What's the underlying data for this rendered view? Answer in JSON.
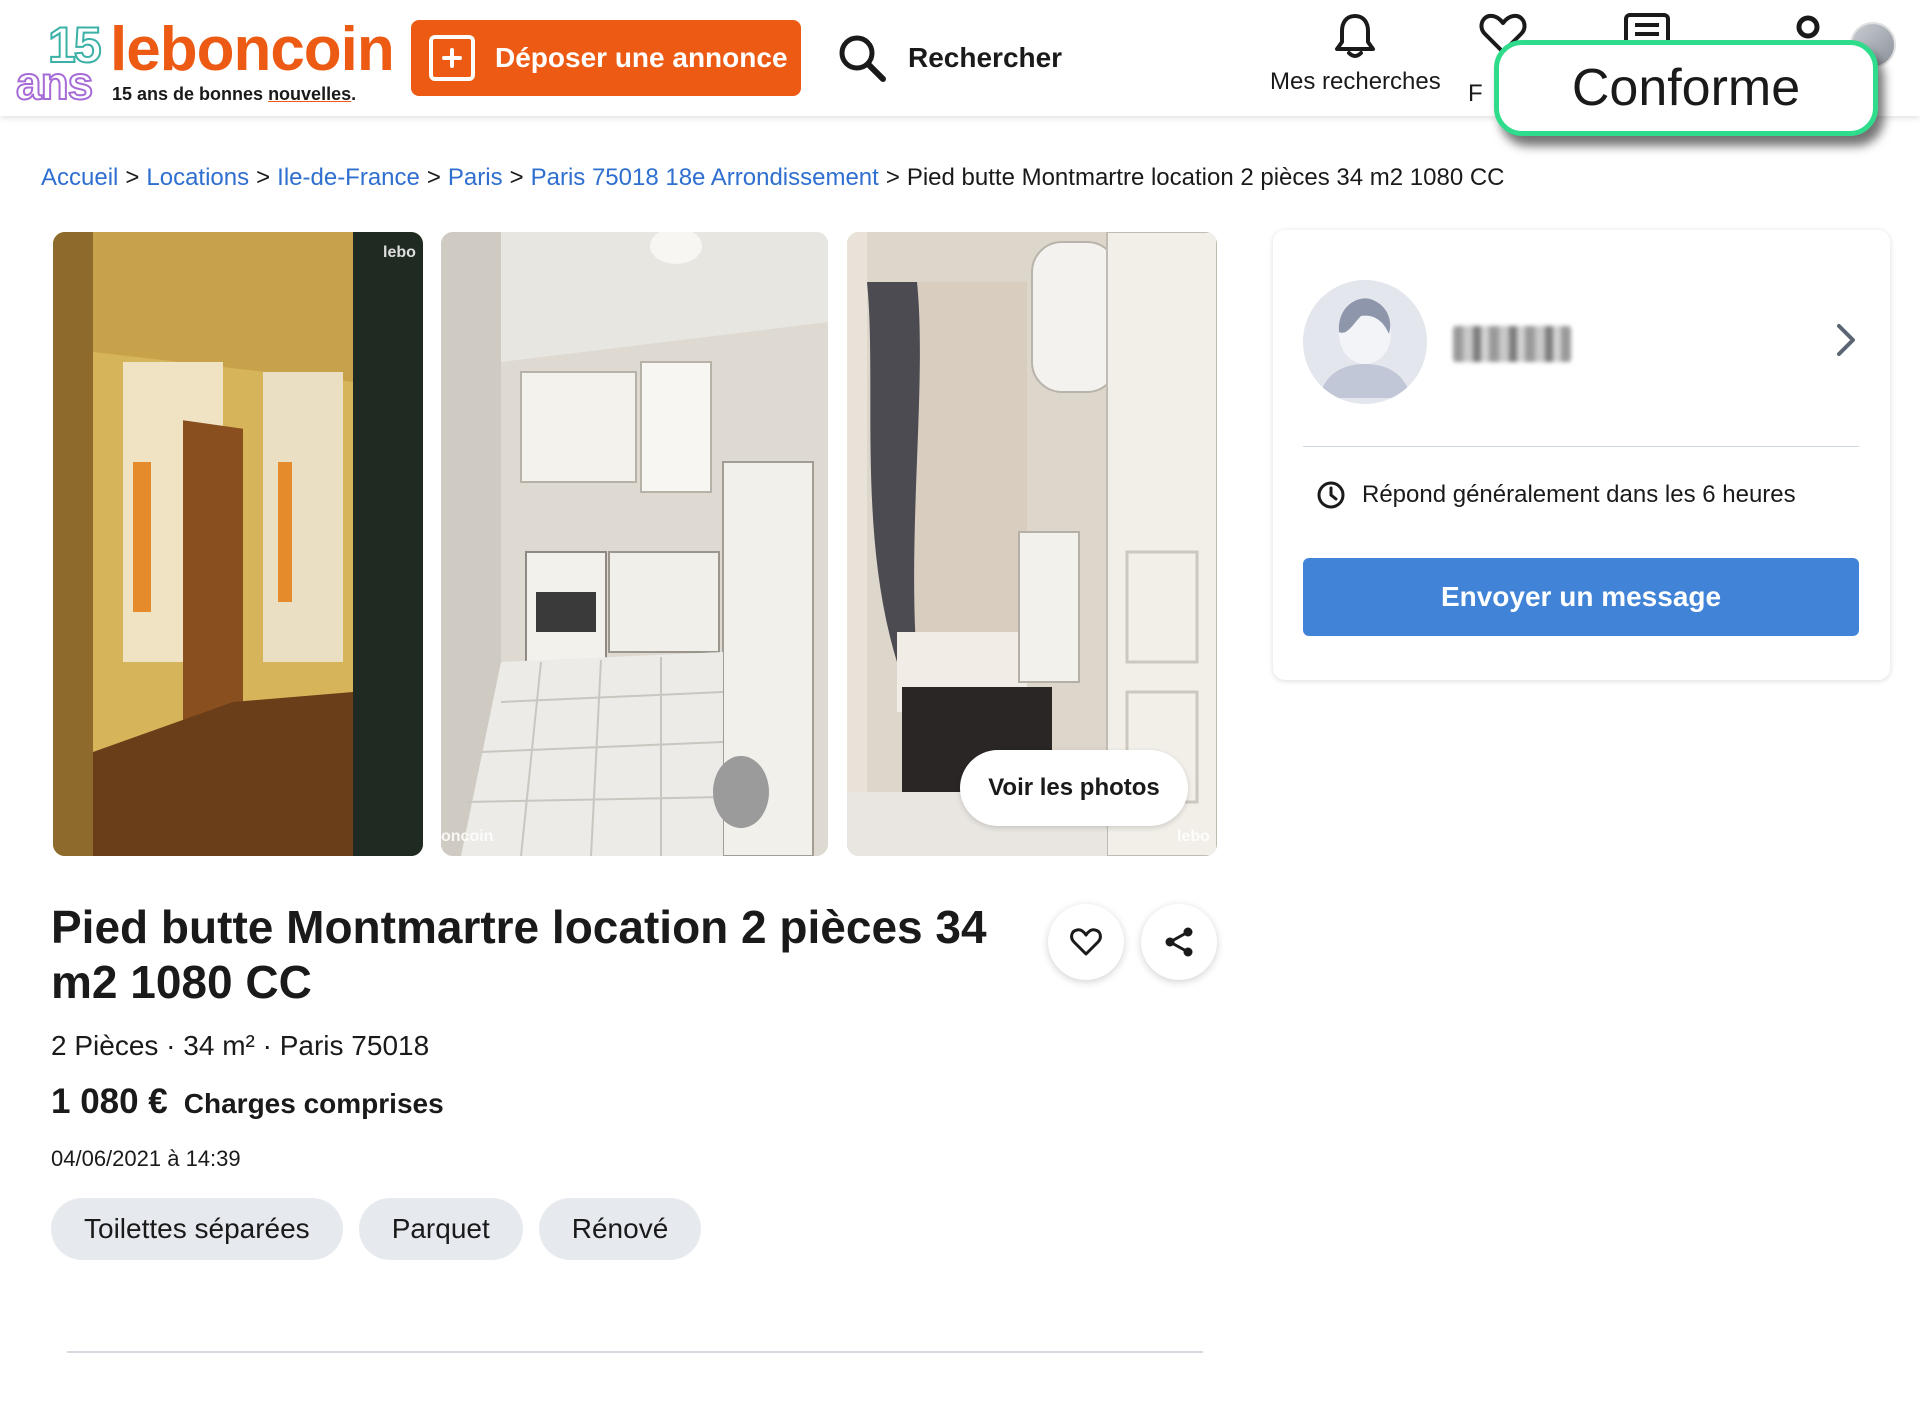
{
  "header": {
    "logo_fifteen": "15",
    "logo_ans": "ans",
    "logo_brand": "leboncoin",
    "logo_tagline_prefix": "15 ans de bonnes ",
    "logo_tagline_underlined": "nouvelles",
    "logo_tagline_suffix": ".",
    "post_button": "Déposer une annonce",
    "search_label": "Rechercher",
    "nav_saved_searches": "Mes recherches",
    "nav_favorites_partial": "F",
    "overlay_badge": "Conforme"
  },
  "breadcrumb": {
    "items": [
      "Accueil",
      "Locations",
      "Ile-de-France",
      "Paris",
      "Paris 75018 18e Arrondissement"
    ],
    "current": "Pied butte Montmartre location 2 pièces 34 m2 1080 CC"
  },
  "gallery": {
    "watermark_1": "lebo",
    "watermark_2": "oncoin",
    "watermark_3": "lebo",
    "see_photos": "Voir les photos"
  },
  "seller": {
    "response_time": "Répond généralement dans les 6 heures",
    "send_message": "Envoyer un message"
  },
  "listing": {
    "title": "Pied butte Montmartre location 2 pièces 34 m2 1080 CC",
    "subtitle": "2 Pièces · 34 m² · Paris 75018",
    "price": "1 080 €",
    "charges": "Charges comprises",
    "date": "04/06/2021 à 14:39",
    "tags": [
      "Toilettes séparées",
      "Parquet",
      "Rénové"
    ]
  },
  "colors": {
    "brand_orange": "#ec5a13",
    "link_blue": "#2f6fcf",
    "button_blue": "#4183d7",
    "badge_green": "#2fdc8b"
  },
  "icons": [
    "plus-icon",
    "search-icon",
    "bell-icon",
    "heart-icon",
    "message-icon",
    "user-icon",
    "chevron-right-icon",
    "clock-icon",
    "share-icon"
  ]
}
